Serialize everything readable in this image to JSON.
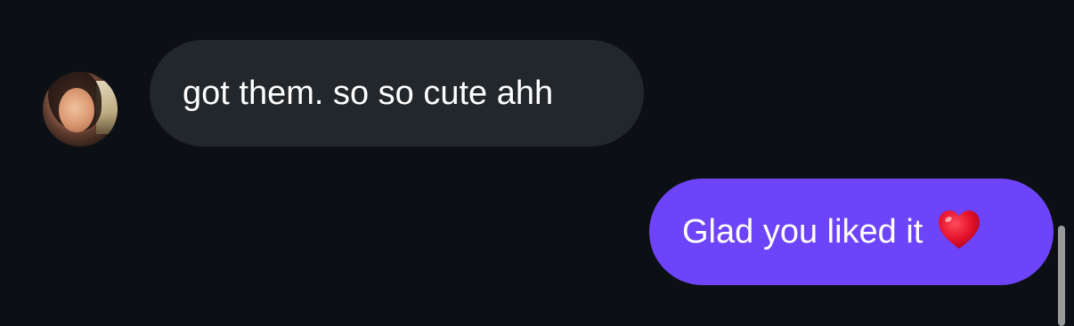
{
  "conversation": {
    "messages": [
      {
        "sender": "them",
        "text": "got them. so so cute ahh"
      },
      {
        "sender": "me",
        "text": "Glad you liked it",
        "emoji": "heart-emoji"
      }
    ]
  },
  "colors": {
    "background": "#0c1015",
    "incoming_bubble": "#22272c",
    "outgoing_bubble": "#6d44fa",
    "text": "#ffffff",
    "heart": "#e3102a"
  }
}
